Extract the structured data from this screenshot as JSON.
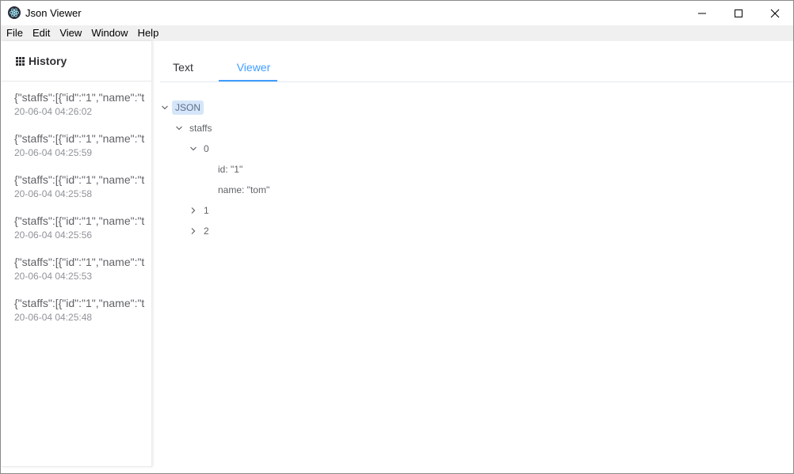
{
  "window": {
    "title": "Json Viewer",
    "icon": "electron-app-icon",
    "controls": [
      "minimize-icon",
      "maximize-icon",
      "close-icon"
    ]
  },
  "menu": [
    "File",
    "Edit",
    "View",
    "Window",
    "Help"
  ],
  "sidebar": {
    "title": "History",
    "icon": "grid-icon",
    "items": [
      {
        "json": "{\"staffs\":[{\"id\":\"1\",\"name\":\"t",
        "time": "20-06-04 04:26:02"
      },
      {
        "json": "{\"staffs\":[{\"id\":\"1\",\"name\":\"t",
        "time": "20-06-04 04:25:59"
      },
      {
        "json": "{\"staffs\":[{\"id\":\"1\",\"name\":\"t",
        "time": "20-06-04 04:25:58"
      },
      {
        "json": "{\"staffs\":[{\"id\":\"1\",\"name\":\"t",
        "time": "20-06-04 04:25:56"
      },
      {
        "json": "{\"staffs\":[{\"id\":\"1\",\"name\":\"t",
        "time": "20-06-04 04:25:53"
      },
      {
        "json": "{\"staffs\":[{\"id\":\"1\",\"name\":\"t",
        "time": "20-06-04 04:25:48"
      }
    ]
  },
  "tabs": {
    "text": "Text",
    "viewer": "Viewer",
    "active": "Viewer"
  },
  "tree": {
    "root": "JSON",
    "staffs": "staffs",
    "item0": "0",
    "id": "id: \"1\"",
    "name": "name: \"tom\"",
    "item1": "1",
    "item2": "2"
  },
  "colors": {
    "accent": "#409eff",
    "root_highlight": "#d6e6f9",
    "menubar": "#f0f0f0"
  }
}
